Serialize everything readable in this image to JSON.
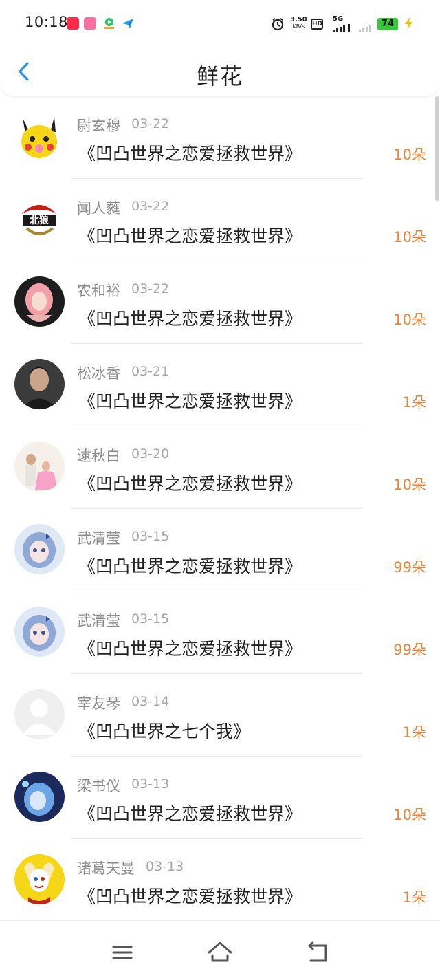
{
  "status_bar": {
    "time": "10:18",
    "net_speed_value": "3.50",
    "net_speed_unit": "KB/s",
    "network_type": "5G",
    "battery_level": "74",
    "icons": [
      "tmall-app-icon",
      "bilibili-app-icon",
      "video-app-icon",
      "paper-plane-app-icon",
      "alarm-icon",
      "hd-icon",
      "signal-icon",
      "battery-icon",
      "charging-icon"
    ]
  },
  "header": {
    "title": "鲜花",
    "back_icon": "chevron-left-icon"
  },
  "colors": {
    "accent_blue": "#2a9af0",
    "amount_orange": "#e8863a",
    "name_gray": "#8d8d8d",
    "date_gray": "#a8a8a8"
  },
  "records": [
    {
      "name": "尉玄穆",
      "date": "03-22",
      "book": "《凹凸世界之恋爱拯救世界》",
      "amount": "10朵",
      "avatar": "pikachu-avatar"
    },
    {
      "name": "闻人蕤",
      "date": "03-22",
      "book": "《凹凸世界之恋爱拯救世界》",
      "amount": "10朵",
      "avatar": "wolf-logo-avatar"
    },
    {
      "name": "农和裕",
      "date": "03-22",
      "book": "《凹凸世界之恋爱拯救世界》",
      "amount": "10朵",
      "avatar": "pink-hair-girl-avatar"
    },
    {
      "name": "松冰香",
      "date": "03-21",
      "book": "《凹凸世界之恋爱拯救世界》",
      "amount": "1朵",
      "avatar": "man-portrait-avatar"
    },
    {
      "name": "逮秋白",
      "date": "03-20",
      "book": "《凹凸世界之恋爱拯救世界》",
      "amount": "10朵",
      "avatar": "family-photo-avatar"
    },
    {
      "name": "武清莹",
      "date": "03-15",
      "book": "《凹凸世界之恋爱拯救世界》",
      "amount": "99朵",
      "avatar": "anime-girl-avatar"
    },
    {
      "name": "武清莹",
      "date": "03-15",
      "book": "《凹凸世界之恋爱拯救世界》",
      "amount": "99朵",
      "avatar": "anime-girl-avatar"
    },
    {
      "name": "宰友琴",
      "date": "03-14",
      "book": "《凹凸世界之七个我》",
      "amount": "1朵",
      "avatar": "default-user-avatar"
    },
    {
      "name": "梁书仪",
      "date": "03-13",
      "book": "《凹凸世界之恋爱拯救世界》",
      "amount": "10朵",
      "avatar": "anime-blue-avatar"
    },
    {
      "name": "诸葛天曼",
      "date": "03-13",
      "book": "《凹凸世界之恋爱拯救世界》",
      "amount": "1朵",
      "avatar": "harley-quinn-avatar"
    }
  ],
  "nav_bar": {
    "icons": [
      "menu-icon",
      "home-icon",
      "back-icon"
    ]
  }
}
